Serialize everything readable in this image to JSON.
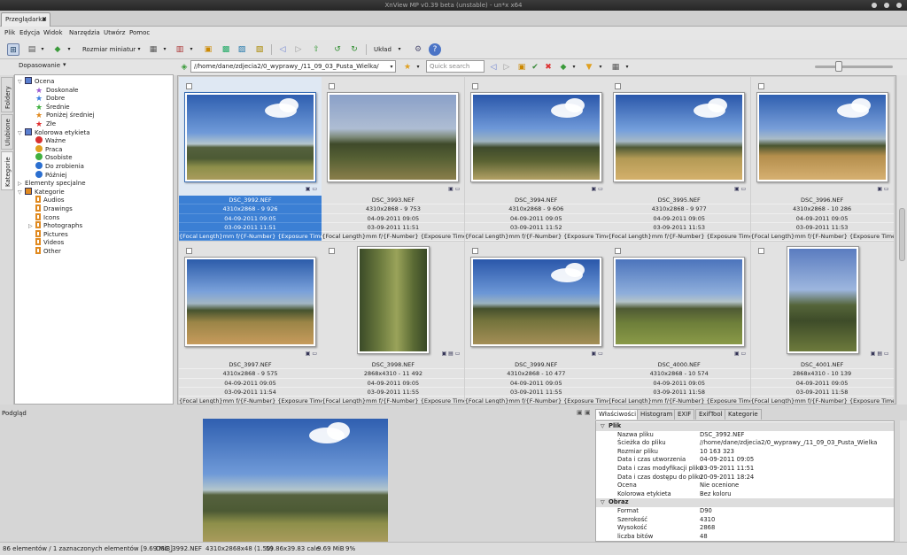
{
  "window": {
    "title": "XnView MP v0.39 beta (unstable) - un*x x64"
  },
  "tabs": [
    {
      "label": "Przeglądarka"
    }
  ],
  "menu": [
    "Plik",
    "Edycja",
    "Widok",
    "Narzędzia",
    "Utwórz",
    "Pomoc"
  ],
  "toolbar": {
    "thumb_size_label": "Rozmiar miniatur",
    "layout_label": "Układ"
  },
  "sidebar": {
    "vertical_tabs": [
      "Foldery",
      "Ulubione",
      "Kategorie"
    ],
    "fit_label": "Dopasowanie"
  },
  "tree": [
    {
      "label": "Ocena",
      "level": 0,
      "expander": "▽",
      "icon": "star-blue-icon",
      "color": "#5a7fd0"
    },
    {
      "label": "Doskonałe",
      "level": 1,
      "icon": "star-icon",
      "color": "#9b59d0"
    },
    {
      "label": "Dobre",
      "level": 1,
      "icon": "star-icon",
      "color": "#3a7fe0"
    },
    {
      "label": "Średnie",
      "level": 1,
      "icon": "star-icon",
      "color": "#40b040"
    },
    {
      "label": "Poniżej średniej",
      "level": 1,
      "icon": "star-icon",
      "color": "#e08a20"
    },
    {
      "label": "Złe",
      "level": 1,
      "icon": "star-icon",
      "color": "#e03030"
    },
    {
      "label": "Kolorowa etykieta",
      "level": 0,
      "expander": "▽",
      "icon": "palette-icon",
      "color": "#5a7fd0"
    },
    {
      "label": "Ważne",
      "level": 1,
      "icon": "circle-icon",
      "color": "#d83030"
    },
    {
      "label": "Praca",
      "level": 1,
      "icon": "circle-icon",
      "color": "#e0a020"
    },
    {
      "label": "Osobiste",
      "level": 1,
      "icon": "circle-icon",
      "color": "#40b040"
    },
    {
      "label": "Do zrobienia",
      "level": 1,
      "icon": "circle-icon",
      "color": "#2b6fd0"
    },
    {
      "label": "Później",
      "level": 1,
      "icon": "circle-icon",
      "color": "#2b6fd0"
    },
    {
      "label": "Elementy specjalne",
      "level": 0,
      "expander": "▷",
      "icon": "",
      "color": ""
    },
    {
      "label": "Kategorie",
      "level": 0,
      "expander": "▽",
      "icon": "folder-icon",
      "color": "#e08a20"
    },
    {
      "label": "Audios",
      "level": 1,
      "icon": "tag-icon",
      "color": "#e08a20"
    },
    {
      "label": "Drawings",
      "level": 1,
      "icon": "tag-icon",
      "color": "#e08a20"
    },
    {
      "label": "Icons",
      "level": 1,
      "icon": "tag-icon",
      "color": "#e08a20"
    },
    {
      "label": "Photographs",
      "level": 1,
      "expander": "▷",
      "icon": "tag-icon",
      "color": "#e08a20"
    },
    {
      "label": "Pictures",
      "level": 1,
      "icon": "tag-icon",
      "color": "#e08a20"
    },
    {
      "label": "Videos",
      "level": 1,
      "icon": "tag-icon",
      "color": "#e08a20"
    },
    {
      "label": "Other",
      "level": 1,
      "icon": "tag-icon",
      "color": "#e08a20"
    }
  ],
  "address": {
    "path": "//home/dane/zdjecia2/0_wyprawy_/11_09_03_Pusta_Wielka/",
    "search_placeholder": "Quick search"
  },
  "thumbnails": [
    {
      "name": "DSC_3992.NEF",
      "dims": "4310x2868 - 9 926",
      "created": "04-09-2011 09:05",
      "modified": "03-09-2011 11:51",
      "exif": "{Focal Length}mm f/{F-Number} {Exposure Time}...",
      "selected": true,
      "orientation": "landscape",
      "scene": "sky1"
    },
    {
      "name": "DSC_3993.NEF",
      "dims": "4310x2868 - 9 753",
      "created": "04-09-2011 09:05",
      "modified": "03-09-2011 11:51",
      "exif": "{Focal Length}mm f/{F-Number} {Exposure Time}...",
      "selected": false,
      "orientation": "landscape",
      "scene": "sky2"
    },
    {
      "name": "DSC_3994.NEF",
      "dims": "4310x2868 - 9 606",
      "created": "04-09-2011 09:05",
      "modified": "03-09-2011 11:52",
      "exif": "{Focal Length}mm f/{F-Number} {Exposure Time}...",
      "selected": false,
      "orientation": "landscape",
      "scene": "sky3"
    },
    {
      "name": "DSC_3995.NEF",
      "dims": "4310x2868 - 9 977",
      "created": "04-09-2011 09:05",
      "modified": "03-09-2011 11:53",
      "exif": "{Focal Length}mm f/{F-Number} {Exposure Time}...",
      "selected": false,
      "orientation": "landscape",
      "scene": "sky4"
    },
    {
      "name": "DSC_3996.NEF",
      "dims": "4310x2868 - 10 286",
      "created": "04-09-2011 09:05",
      "modified": "03-09-2011 11:53",
      "exif": "{Focal Length}mm f/{F-Number} {Exposure Time}...",
      "selected": false,
      "orientation": "landscape",
      "scene": "sky5"
    },
    {
      "name": "DSC_3997.NEF",
      "dims": "4310x2868 - 9 575",
      "created": "04-09-2011 09:05",
      "modified": "03-09-2011 11:54",
      "exif": "{Focal Length}mm f/{F-Number} {Exposure Time}...",
      "selected": false,
      "orientation": "landscape",
      "scene": "sky6"
    },
    {
      "name": "DSC_3998.NEF",
      "dims": "2868x4310 - 11 492",
      "created": "04-09-2011 09:05",
      "modified": "03-09-2011 11:55",
      "exif": "{Focal Length}mm f/{F-Number} {Exposure Time}...",
      "selected": false,
      "orientation": "portrait",
      "scene": "sky7"
    },
    {
      "name": "DSC_3999.NEF",
      "dims": "4310x2868 - 10 477",
      "created": "04-09-2011 09:05",
      "modified": "03-09-2011 11:55",
      "exif": "{Focal Length}mm f/{F-Number} {Exposure Time}...",
      "selected": false,
      "orientation": "landscape",
      "scene": "sky8"
    },
    {
      "name": "DSC_4000.NEF",
      "dims": "4310x2868 - 10 574",
      "created": "04-09-2011 09:05",
      "modified": "03-09-2011 11:58",
      "exif": "{Focal Length}mm f/{F-Number} {Exposure Time}...",
      "selected": false,
      "orientation": "landscape",
      "scene": "sky9"
    },
    {
      "name": "DSC_4001.NEF",
      "dims": "2868x4310 - 10 139",
      "created": "04-09-2011 09:05",
      "modified": "03-09-2011 11:58",
      "exif": "{Focal Length}mm f/{F-Number} {Exposure Time}...",
      "selected": false,
      "orientation": "portrait",
      "scene": "sky10"
    }
  ],
  "preview": {
    "title": "Podgląd"
  },
  "properties": {
    "tabs": [
      "Właściwości",
      "Histogram",
      "EXIF",
      "ExifTool",
      "Kategorie"
    ],
    "rows": [
      {
        "group": true,
        "key": "Plik",
        "value": ""
      },
      {
        "key": "Nazwa pliku",
        "value": "DSC_3992.NEF"
      },
      {
        "key": "Ścieżka do pliku",
        "value": "//home/dane/zdjecia2/0_wyprawy_/11_09_03_Pusta_Wielka"
      },
      {
        "key": "Rozmiar pliku",
        "value": "10 163 323"
      },
      {
        "key": "Data i czas utworzenia",
        "value": "04-09-2011 09:05"
      },
      {
        "key": "Data i czas modyfikacji pliku",
        "value": "03-09-2011 11:51"
      },
      {
        "key": "Data i czas dostępu do pliku",
        "value": "20-09-2011 18:24"
      },
      {
        "key": "Ocena",
        "value": "Nie ocenione"
      },
      {
        "key": "Kolorowa etykieta",
        "value": "Bez koloru"
      },
      {
        "group": true,
        "key": "Obraz",
        "value": ""
      },
      {
        "key": "Format",
        "value": "D90"
      },
      {
        "key": "Szerokość",
        "value": "4310"
      },
      {
        "key": "Wysokość",
        "value": "2868"
      },
      {
        "key": "liczba bitów",
        "value": "48"
      }
    ]
  },
  "status": {
    "count": "86 elementów / 1 zaznaczonych elementów [9.69 MiB]",
    "file": "DSC_3992.NEF",
    "dims": "4310x2868x48 (1.50)",
    "size_in": "59.86x39.83 cale",
    "mib": "9.69 MiB",
    "zoom": "9%"
  }
}
